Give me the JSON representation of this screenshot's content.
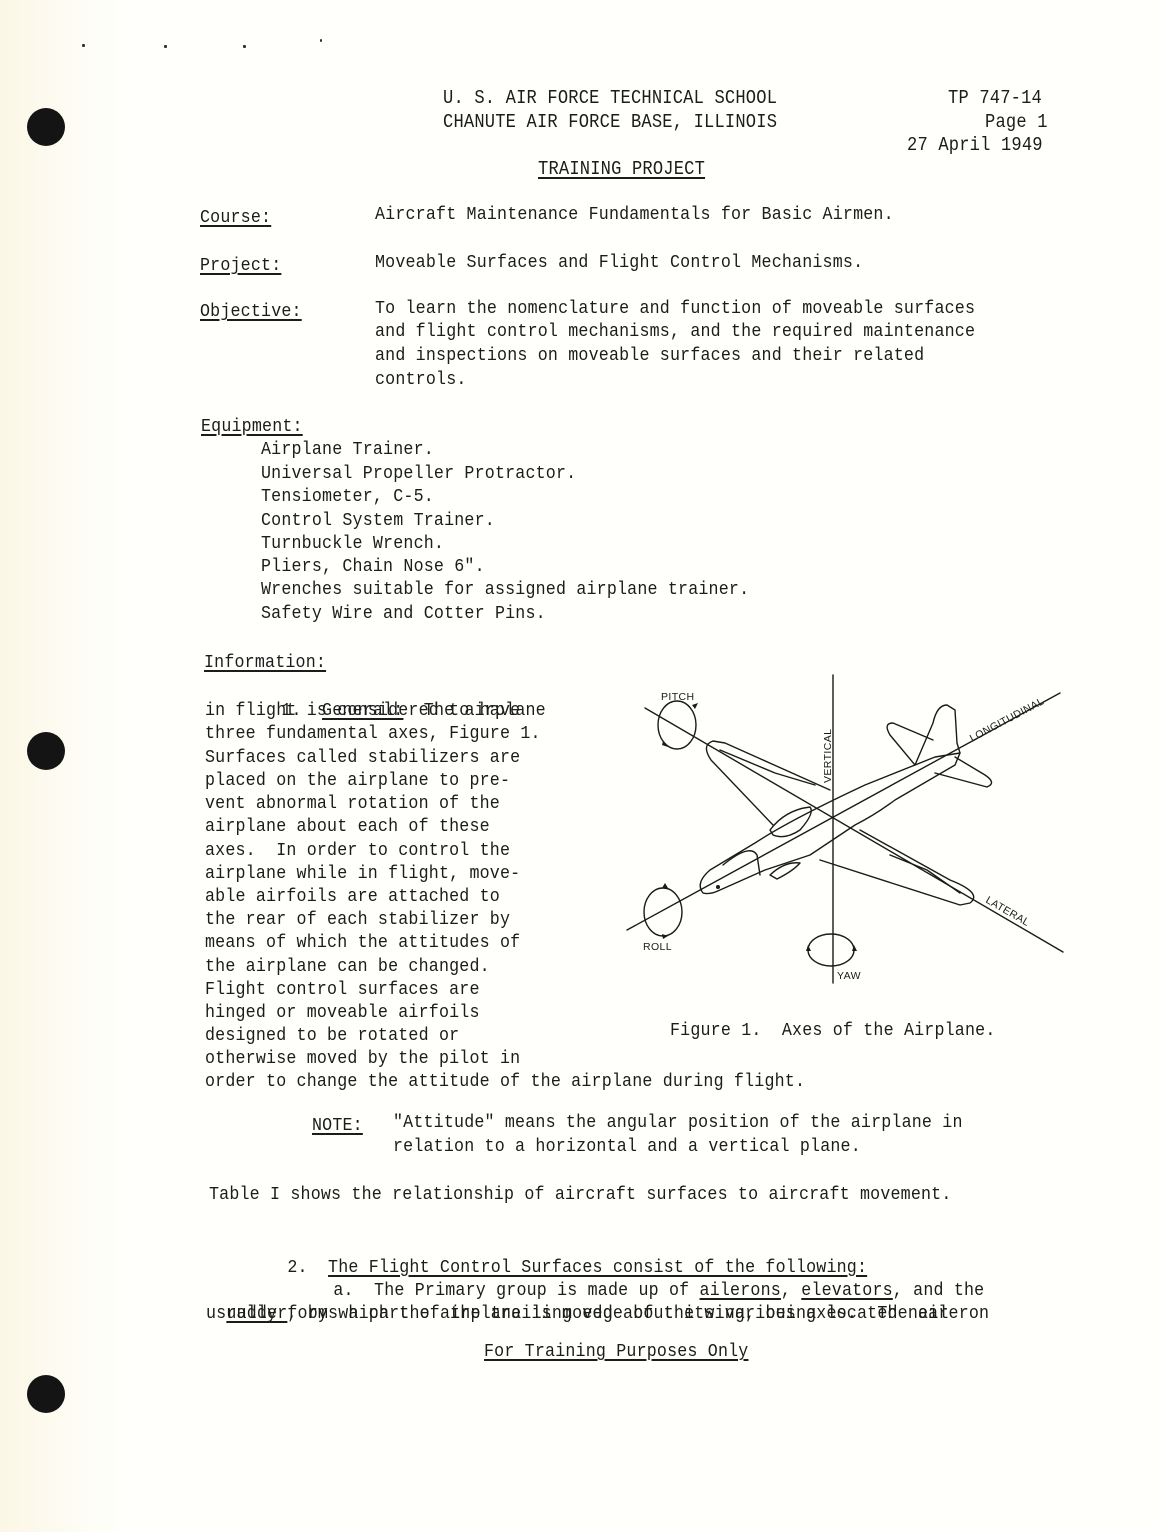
{
  "header": {
    "org_line1": "U. S. AIR FORCE TECHNICAL SCHOOL",
    "org_line2": "CHANUTE AIR FORCE BASE, ILLINOIS",
    "doc_number": "TP 747-14",
    "page": "Page 1",
    "date": "27 April 1949",
    "title": "TRAINING PROJECT"
  },
  "fields": {
    "course_label": "Course:",
    "course_value": "Aircraft Maintenance Fundamentals for Basic Airmen.",
    "project_label": "Project:",
    "project_value": "Moveable Surfaces and Flight Control Mechanisms.",
    "objective_label": "Objective:",
    "objective_lines": [
      "To learn the nomenclature and function of moveable surfaces",
      "and flight control mechanisms, and the required maintenance",
      "and inspections on moveable surfaces and their related",
      "controls."
    ]
  },
  "equipment": {
    "label": "Equipment:",
    "items": [
      "Airplane Trainer.",
      "Universal Propeller Protractor.",
      "Tensiometer, C-5.",
      "Control System Trainer.",
      "Turnbuckle Wrench.",
      "Pliers, Chain Nose 6\".",
      "Wrenches suitable for assigned airplane trainer.",
      "Safety Wire and Cotter Pins."
    ]
  },
  "information": {
    "label": "Information:",
    "para1_number": "1.",
    "para1_heading": "General:",
    "para1_first": "  The airplane",
    "para1_lines": [
      "in flight is considered to have",
      "three fundamental axes, Figure 1.",
      "Surfaces called stabilizers are",
      "placed on the airplane to pre-",
      "vent abnormal rotation of the",
      "airplane about each of these",
      "axes.  In order to control the",
      "airplane while in flight, move-",
      "able airfoils are attached to",
      "the rear of each stabilizer by",
      "means of which the attitudes of",
      "the airplane can be changed.",
      "Flight control surfaces are",
      "hinged or moveable airfoils",
      "designed to be rotated or",
      "otherwise moved by the pilot in",
      "order to change the attitude of the airplane during flight."
    ],
    "note_label": "NOTE:",
    "note_lines": [
      "\"Attitude\" means the angular position of the airplane in",
      "relation to a horizontal and a vertical plane."
    ],
    "table_ref": "Table I shows the relationship of aircraft surfaces to aircraft movement.",
    "para2_number": "2.",
    "para2_heading": "The Flight Control Surfaces consist of the following:",
    "para2a_prefix": "a.  The Primary group is made up of ",
    "para2a_term1": "ailerons",
    "para2a_sep1": ", ",
    "para2a_term2": "elevators",
    "para2a_sep2": ", and the",
    "para2a_term3": "rudder",
    "para2a_line2_rest": ", by which the airplane is moved about its various axes.  The aileron",
    "para2a_line3": "usually forms a part of the trailing edge of the wing, being located near"
  },
  "figure": {
    "caption": "Figure 1.  Axes of the Airplane.",
    "labels": {
      "pitch": "PITCH",
      "roll": "ROLL",
      "yaw": "YAW",
      "vertical": "VERTICAL",
      "longitudinal": "LONGITUDINAL",
      "lateral": "LATERAL"
    }
  },
  "footer": {
    "text": "For Training Purposes Only"
  }
}
